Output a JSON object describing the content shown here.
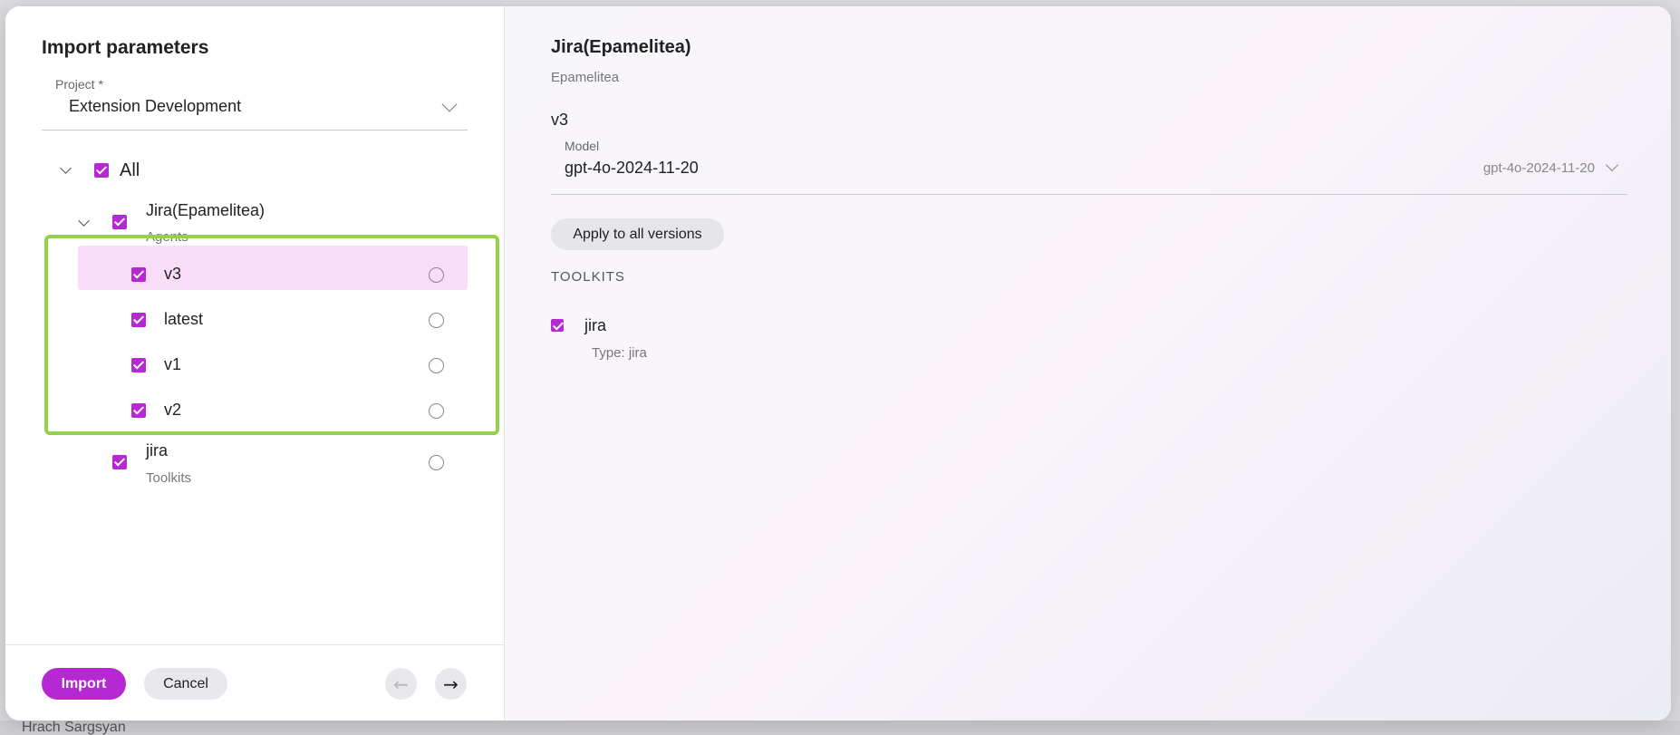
{
  "background": {
    "user_name": "Hrach Sargsyan"
  },
  "import_panel": {
    "title": "Import parameters",
    "project_label": "Project *",
    "project_value": "Extension Development",
    "tree": {
      "all_label": "All",
      "agent": {
        "name": "Jira(Epamelitea)",
        "type": "Agents",
        "versions": [
          {
            "label": "v3",
            "selected": true
          },
          {
            "label": "latest",
            "selected": false
          },
          {
            "label": "v1",
            "selected": false
          },
          {
            "label": "v2",
            "selected": false
          }
        ]
      },
      "toolkit": {
        "name": "jira",
        "type": "Toolkits"
      }
    },
    "footer": {
      "import_label": "Import",
      "cancel_label": "Cancel",
      "prev_icon": "arrow-left-icon",
      "next_icon": "arrow-right-icon"
    }
  },
  "detail_panel": {
    "title": "Jira(Epamelitea)",
    "subtitle": "Epamelitea",
    "version": "v3",
    "model_label": "Model",
    "model_value": "gpt-4o-2024-11-20",
    "model_select_display": "gpt-4o-2024-11-20",
    "apply_label": "Apply to all versions",
    "toolkits_heading": "TOOLKITS",
    "toolkits": [
      {
        "name": "jira",
        "type": "Type: jira"
      }
    ]
  },
  "colors": {
    "accent": "#b528d2",
    "selected_row": "#f9dcf7",
    "highlight_border": "#93d14a"
  }
}
